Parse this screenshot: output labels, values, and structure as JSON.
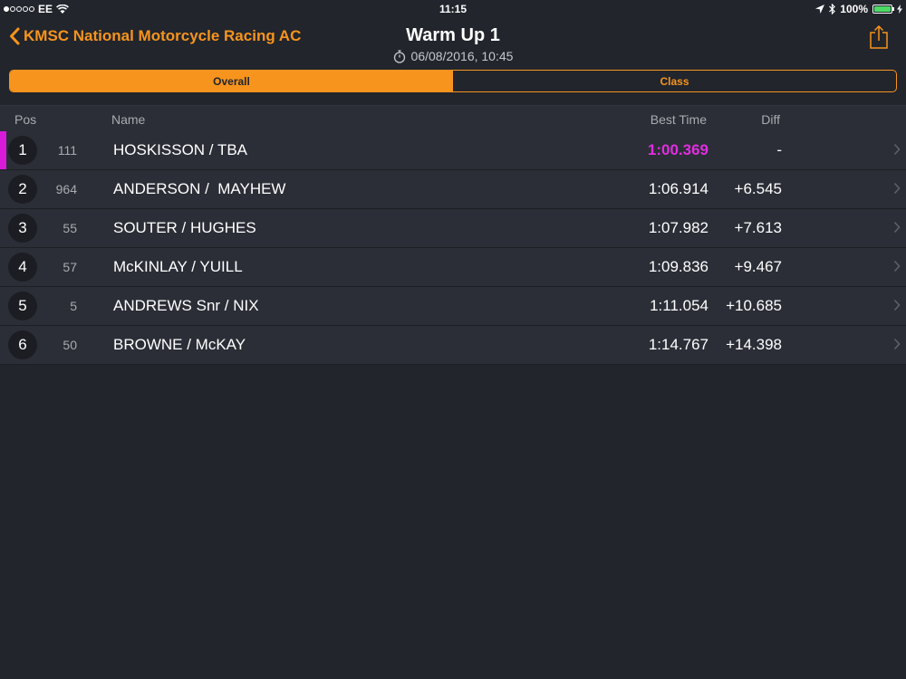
{
  "status_bar": {
    "carrier": "EE",
    "time": "11:15",
    "battery": "100%",
    "battery_level": 1.0
  },
  "nav": {
    "back_label": "KMSC National Motorcycle Racing AC",
    "title": "Warm Up 1",
    "subtitle": "06/08/2016, 10:45"
  },
  "tabs": [
    {
      "label": "Overall",
      "active": true
    },
    {
      "label": "Class",
      "active": false
    }
  ],
  "columns": {
    "pos": "Pos",
    "name": "Name",
    "best_time": "Best Time",
    "diff": "Diff"
  },
  "rows": [
    {
      "pos": "1",
      "number": "111",
      "name": "HOSKISSON / TBA",
      "best_time": "1:00.369",
      "diff": "-",
      "fastest": true
    },
    {
      "pos": "2",
      "number": "964",
      "name": "ANDERSON /  MAYHEW",
      "best_time": "1:06.914",
      "diff": "+6.545",
      "fastest": false
    },
    {
      "pos": "3",
      "number": "55",
      "name": "SOUTER / HUGHES",
      "best_time": "1:07.982",
      "diff": "+7.613",
      "fastest": false
    },
    {
      "pos": "4",
      "number": "57",
      "name": "McKINLAY / YUILL",
      "best_time": "1:09.836",
      "diff": "+9.467",
      "fastest": false
    },
    {
      "pos": "5",
      "number": "5",
      "name": "ANDREWS Snr / NIX",
      "best_time": "1:11.054",
      "diff": "+10.685",
      "fastest": false
    },
    {
      "pos": "6",
      "number": "50",
      "name": "BROWNE / McKAY",
      "best_time": "1:14.767",
      "diff": "+14.398",
      "fastest": false
    }
  ],
  "colors": {
    "accent": "#f7941d",
    "fastest": "#e02ee0",
    "background": "#22252c",
    "row": "#2b2e36"
  }
}
